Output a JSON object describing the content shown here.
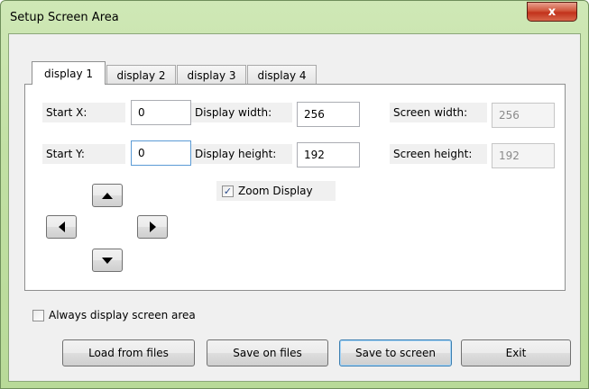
{
  "window": {
    "title": "Setup Screen Area",
    "close_glyph": "x"
  },
  "tabs": [
    {
      "label": "display 1",
      "active": true
    },
    {
      "label": "display 2",
      "active": false
    },
    {
      "label": "display 3",
      "active": false
    },
    {
      "label": "display 4",
      "active": false
    }
  ],
  "form": {
    "start_x": {
      "label": "Start X:",
      "value": "0"
    },
    "start_y": {
      "label": "Start Y:",
      "value": "0"
    },
    "display_width": {
      "label": "Display width:",
      "value": "256"
    },
    "display_height": {
      "label": "Display height:",
      "value": "192"
    },
    "screen_width": {
      "label": "Screen width:",
      "value": "256"
    },
    "screen_height": {
      "label": "Screen height:",
      "value": "192"
    },
    "zoom_display": {
      "label": "Zoom Display",
      "checked": true
    }
  },
  "arrows": {
    "up": "up-arrow-icon",
    "down": "down-arrow-icon",
    "left": "left-arrow-icon",
    "right": "right-arrow-icon"
  },
  "always_display": {
    "label": "Always display screen area",
    "checked": false
  },
  "buttons": {
    "load": "Load from files",
    "save_files": "Save on files",
    "save_screen": "Save to screen",
    "exit": "Exit"
  },
  "colors": {
    "frame": "#c2e0a4",
    "close": "#c2321b",
    "default_button_border": "#3c7fb1"
  }
}
